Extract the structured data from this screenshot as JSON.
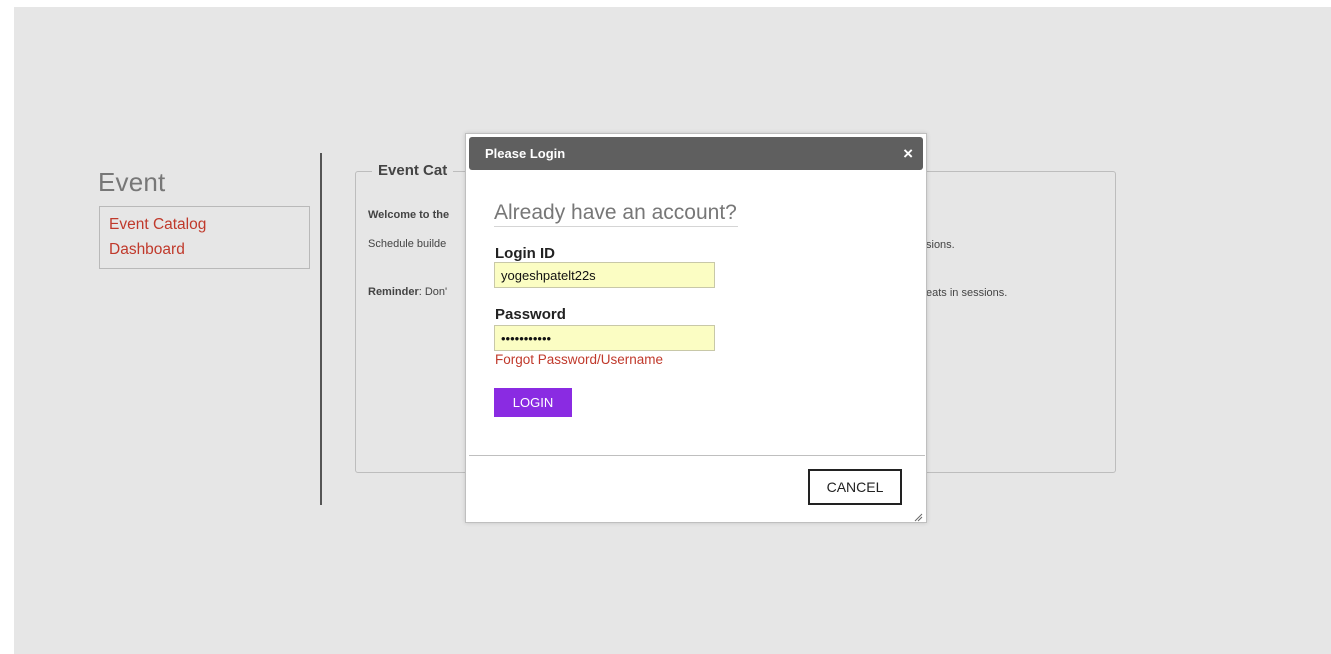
{
  "sidebar": {
    "title": "Event",
    "items": [
      {
        "label": "Event Catalog"
      },
      {
        "label": "Dashboard"
      }
    ]
  },
  "panel": {
    "legend": "Event Cat",
    "welcome_text": "Welcome to the",
    "schedule_text": "Schedule builde",
    "reminder_label": "Reminder",
    "reminder_text": ": Don'",
    "right_text_1": "sions.",
    "right_text_2": "eats in sessions."
  },
  "modal": {
    "title": "Please Login",
    "close_symbol": "×",
    "subtitle": "Already have an account?",
    "login_id_label": "Login ID",
    "login_id_value": "yogeshpatelt22s",
    "password_label": "Password",
    "password_value": "•••••••••••",
    "forgot_link": "Forgot Password/Username",
    "login_button": "LOGIN",
    "cancel_button": "CANCEL"
  },
  "colors": {
    "background": "#e6e6e6",
    "link": "#c0392b",
    "login_button": "#8a2be2",
    "modal_header": "#5f5f5f",
    "input_fill": "#fbfdc3"
  },
  "icons": {
    "close": "close-icon",
    "resize": "resize-grip-icon"
  }
}
